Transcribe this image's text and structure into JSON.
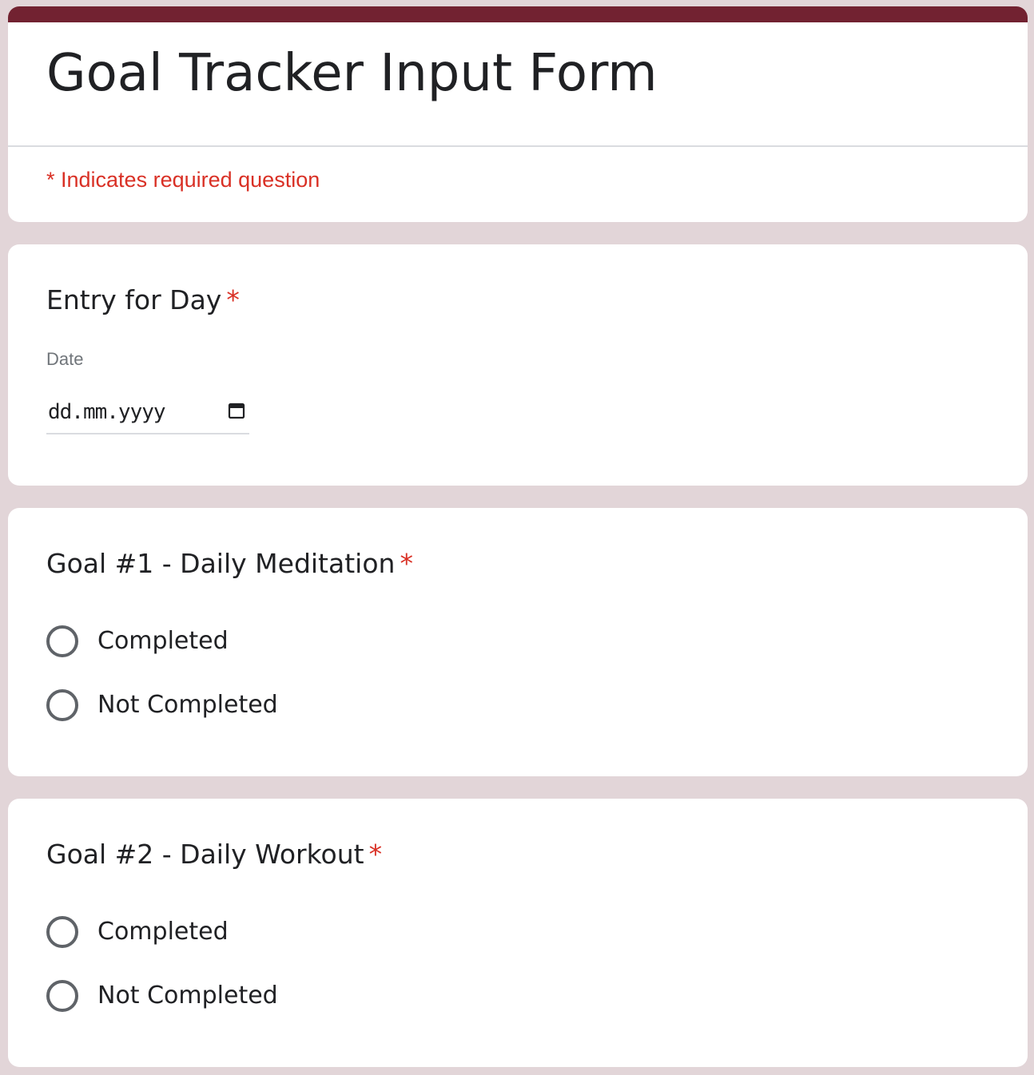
{
  "colors": {
    "page_background": "#e2d5d8",
    "accent_band": "#722231",
    "required": "#d93025",
    "text": "#202124",
    "muted": "#70757a"
  },
  "header": {
    "title": "Goal Tracker Input Form",
    "required_note": "* Indicates required question"
  },
  "questions": [
    {
      "title": "Entry for Day",
      "required_mark": "*",
      "type": "date",
      "field_label": "Date",
      "placeholder": "dd.mm.yyyy",
      "icon": "calendar-icon"
    },
    {
      "title": "Goal #1 - Daily Meditation",
      "required_mark": "*",
      "type": "radio",
      "options": [
        "Completed",
        "Not Completed"
      ],
      "selected": null
    },
    {
      "title": "Goal #2 - Daily Workout",
      "required_mark": "*",
      "type": "radio",
      "options": [
        "Completed",
        "Not Completed"
      ],
      "selected": null
    }
  ]
}
